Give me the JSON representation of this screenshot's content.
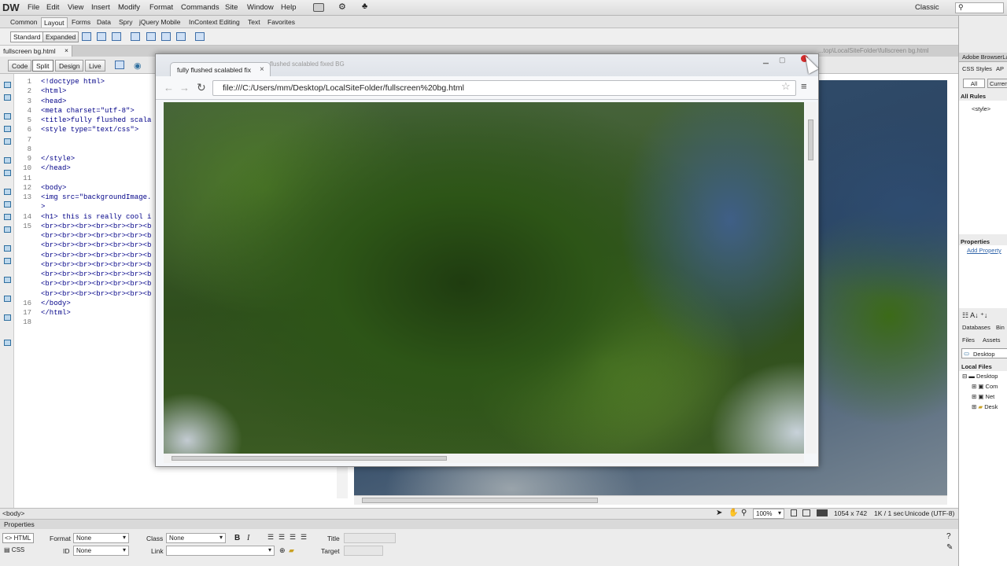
{
  "app": {
    "logo": "DW",
    "menu": [
      "File",
      "Edit",
      "View",
      "Insert",
      "Modify",
      "Format",
      "Commands",
      "Site",
      "Window",
      "Help"
    ],
    "workspace": "Classic"
  },
  "insert_tabs": [
    "Common",
    "Layout",
    "Forms",
    "Data",
    "Spry",
    "jQuery Mobile",
    "InContext Editing",
    "Text",
    "Favorites"
  ],
  "insert_bar": {
    "standard": "Standard",
    "expanded": "Expanded"
  },
  "document": {
    "tab": "fullscreen bg.html",
    "path": "...top\\LocalSiteFolder\\fullscreen bg.html"
  },
  "view_buttons": [
    "Code",
    "Split",
    "Design",
    "Live"
  ],
  "code": {
    "line_numbers": [
      "1",
      "2",
      "3",
      "4",
      "5",
      "6",
      "7",
      "8",
      "9",
      "10",
      "11",
      "12",
      "13",
      "",
      "14",
      "15",
      "",
      "",
      "",
      "",
      "",
      "",
      "",
      "16",
      "17",
      "18"
    ],
    "lines": [
      "<!doctype html>",
      "<html>",
      "<head>",
      "<meta charset=\"utf-8\">",
      "<title>fully flushed scala",
      "<style type=\"text/css\">",
      "",
      "",
      "</style>",
      "</head>",
      "",
      "<body>",
      "<img src=\"backgroundImage.",
      ">",
      "<h1> this is really cool i",
      "<br><br><br><br><br><br><b",
      "<br><br><br><br><br><br><b",
      "<br><br><br><br><br><br><b",
      "<br><br><br><br><br><br><b",
      "<br><br><br><br><br><br><b",
      "<br><br><br><br><br><br><b",
      "<br><br><br><br><br><br><b",
      "<br><br><br><br><br><br><b",
      "</body>",
      "</html>",
      ""
    ]
  },
  "browser": {
    "tab_title": "fully flushed scalabled fix",
    "behind_tab": "flushed scalabled fixed BG",
    "url": "file:///C:/Users/mm/Desktop/LocalSiteFolder/fullscreen%20bg.html"
  },
  "status": {
    "tag": "<body>",
    "zoom": "100%",
    "dims": "1054 x 742",
    "size": "1K / 1 sec",
    "encoding": "Unicode (UTF-8)"
  },
  "properties": {
    "title": "Properties",
    "html": "HTML",
    "css": "CSS",
    "format_label": "Format",
    "format_value": "None",
    "id_label": "ID",
    "id_value": "None",
    "class_label": "Class",
    "class_value": "None",
    "link_label": "Link",
    "title_label": "Title",
    "target_label": "Target"
  },
  "right_panel": {
    "browserlab": "Adobe BrowserLa",
    "css_styles": "CSS Styles",
    "ap": "AP",
    "all": "All",
    "current": "Curren",
    "all_rules": "All Rules",
    "style_rule": "<style>",
    "properties": "Properties",
    "add_property": "Add Property",
    "databases": "Databases",
    "bind": "Bin",
    "files": "Files",
    "assets": "Assets",
    "site_select": "Desktop",
    "local_files": "Local Files",
    "tree": [
      "Desktop",
      "Com",
      "Net",
      "Desk"
    ]
  }
}
